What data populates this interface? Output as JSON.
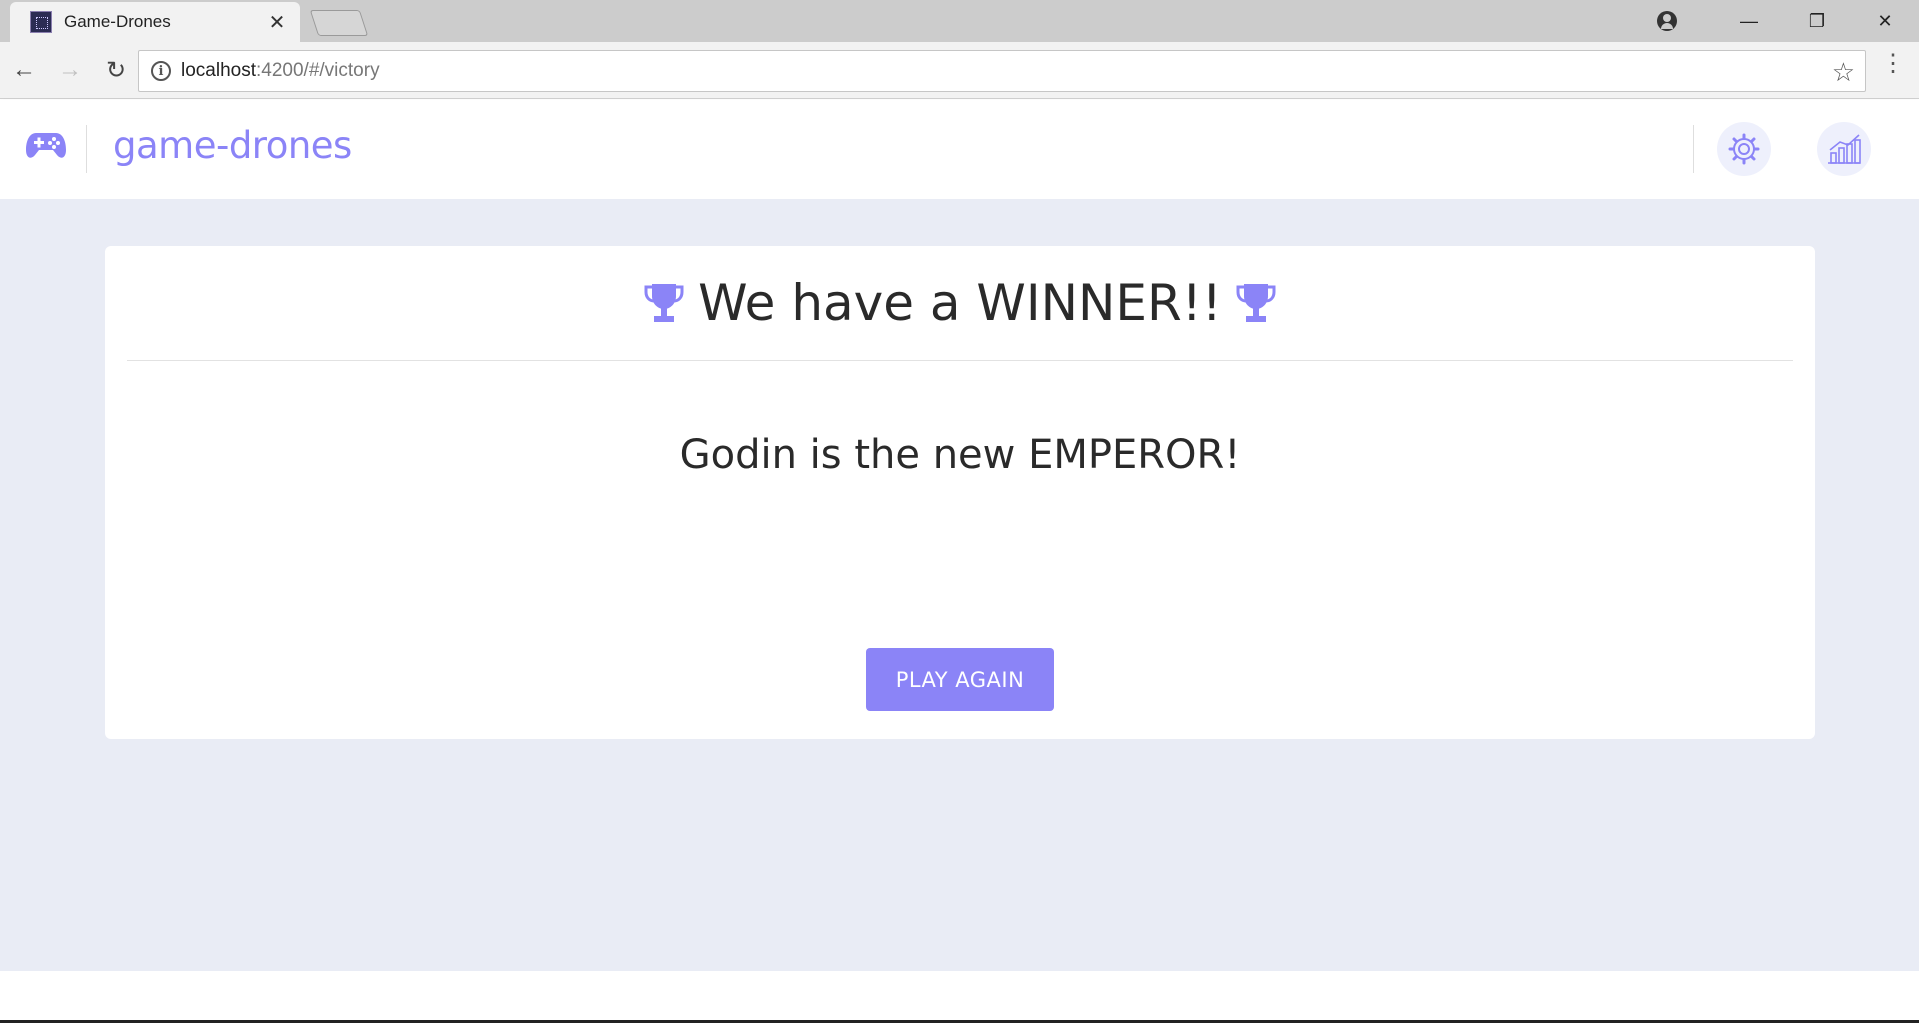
{
  "browser": {
    "tab_title": "Game-Drones",
    "close_glyph": "✕",
    "url_host": "localhost",
    "url_path": ":4200/#/victory",
    "info_glyph": "i",
    "back_glyph": "←",
    "forward_glyph": "→",
    "reload_glyph": "↻",
    "star_glyph": "☆",
    "menu_glyph": "⋮",
    "minimize_glyph": "—",
    "restore_glyph": "❐",
    "window_close_glyph": "✕"
  },
  "header": {
    "brand": "game-drones",
    "accent_color": "#8b84f7"
  },
  "victory": {
    "title": "We have a WINNER!!",
    "message": "Godin is the new EMPEROR!",
    "play_again_label": "PLAY AGAIN"
  },
  "icons": {
    "logo": "gamepad-icon",
    "settings": "gear-icon",
    "stats": "bar-chart-icon",
    "trophy": "trophy-icon"
  }
}
